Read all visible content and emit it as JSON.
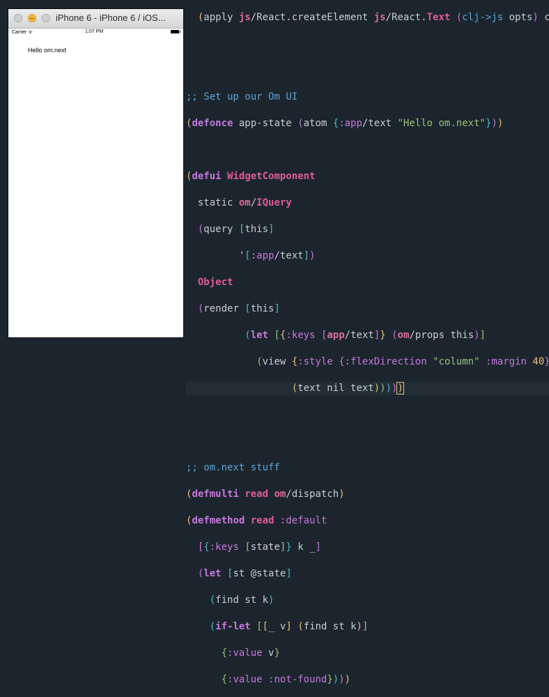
{
  "simulator": {
    "window_title": "iPhone 6 - iPhone 6 / iOS...",
    "status": {
      "carrier": "Carrier ᯤ",
      "time": "1:07 PM"
    },
    "app_text": "Hello om.next"
  },
  "editor": {
    "cursor_line": 14
  }
}
